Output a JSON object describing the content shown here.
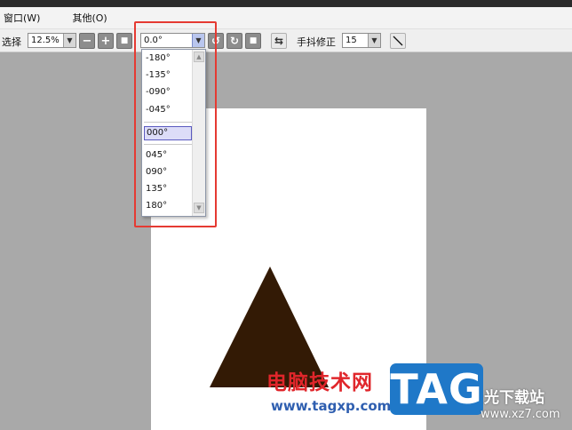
{
  "menubar": {
    "items": [
      {
        "label": "窗口(W)"
      },
      {
        "label": "其他(O)"
      }
    ]
  },
  "toolbar": {
    "select_label": "选择",
    "zoom_value": "12.5%",
    "rotation_value": "0.0°",
    "stabilizer_label": "手抖修正",
    "stabilizer_value": "15"
  },
  "rotation_dropdown": {
    "options": [
      {
        "label": "-180°"
      },
      {
        "label": "-135°"
      },
      {
        "label": "-090°"
      },
      {
        "label": "-045°"
      },
      {
        "label": "000°"
      },
      {
        "label": "045°"
      },
      {
        "label": "090°"
      },
      {
        "label": "135°"
      },
      {
        "label": "180°"
      }
    ],
    "selected": "000°"
  },
  "canvas": {
    "shape": "triangle",
    "shape_color": "#331a05"
  },
  "watermark": {
    "site_cn": "电脑技术网",
    "url": "www.tagxp.com",
    "logo": "TAG",
    "brand2": "光下载站",
    "brand2_url": "www.xz7.com"
  },
  "colors": {
    "highlight": "#e53a32",
    "selection": "#dcdcf8"
  }
}
